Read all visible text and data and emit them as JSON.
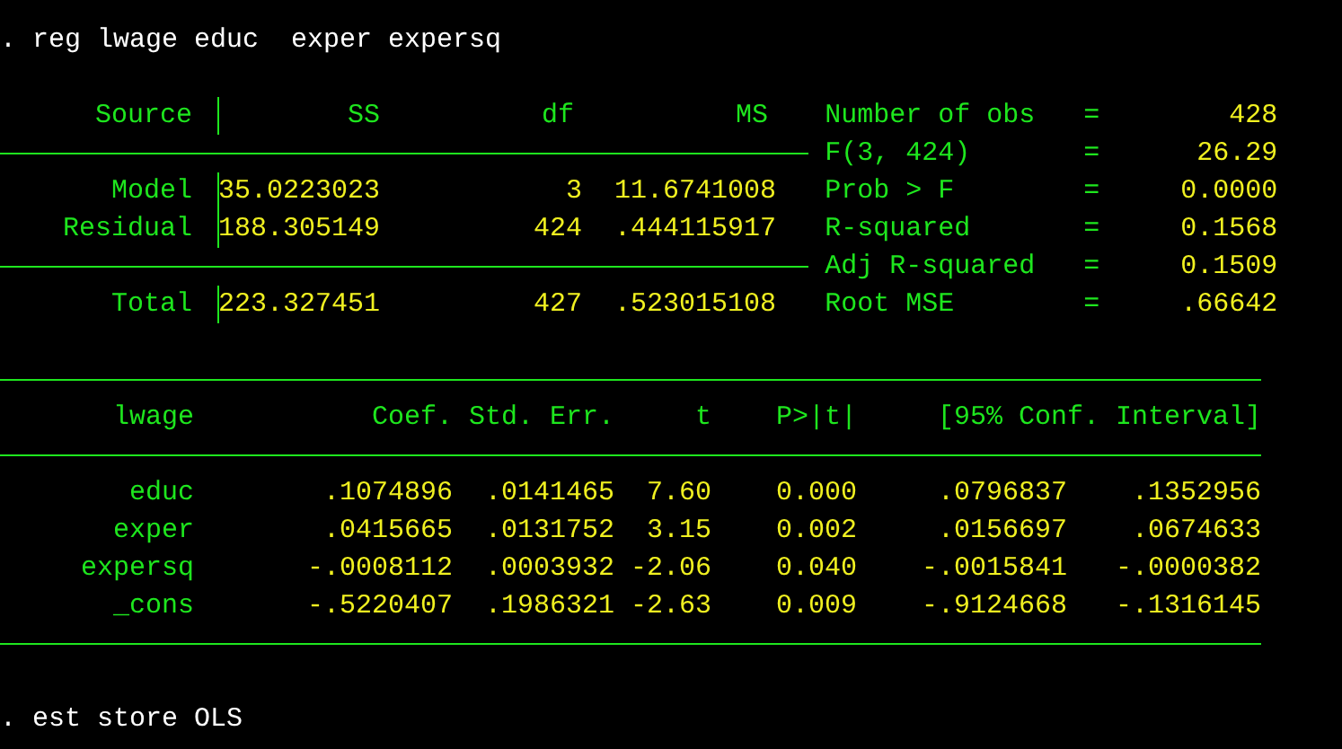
{
  "command": ". reg lwage educ  exper expersq",
  "anova": {
    "columns": [
      "Source",
      "SS",
      "df",
      "MS"
    ],
    "rows": [
      {
        "source": "Model",
        "ss": "35.0223023",
        "df": "3",
        "ms": "11.6741008"
      },
      {
        "source": "Residual",
        "ss": "188.305149",
        "df": "424",
        "ms": ".444115917"
      }
    ],
    "total": {
      "source": "Total",
      "ss": "223.327451",
      "df": "427",
      "ms": ".523015108"
    }
  },
  "stats": [
    {
      "label": "Number of obs",
      "relation": "=",
      "value": "428"
    },
    {
      "label": "F(3, 424)",
      "relation": "=",
      "value": "26.29"
    },
    {
      "label": "Prob > F",
      "relation": "=",
      "value": "0.0000"
    },
    {
      "label": "R-squared",
      "relation": "=",
      "value": "0.1568"
    },
    {
      "label": "Adj R-squared",
      "relation": "=",
      "value": "0.1509"
    },
    {
      "label": "Root MSE",
      "relation": "=",
      "value": ".66642"
    }
  ],
  "coef_table": {
    "columns": [
      "lwage",
      "Coef.",
      "Std. Err.",
      "t",
      "P>|t|",
      "[95% Conf. Interval]"
    ],
    "rows": [
      {
        "name": "educ",
        "values": [
          ".1074896",
          ".0141465",
          "7.60",
          "0.000",
          ".0796837",
          ".1352956"
        ]
      },
      {
        "name": "exper",
        "values": [
          ".0415665",
          ".0131752",
          "3.15",
          "0.002",
          ".0156697",
          ".0674633"
        ]
      },
      {
        "name": "expersq",
        "values": [
          "-.0008112",
          ".0003932",
          "-2.06",
          "0.040",
          "-.0015841",
          "-.0000382"
        ]
      },
      {
        "name": "_cons",
        "values": [
          "-.5220407",
          ".1986321",
          "-2.63",
          "0.009",
          "-.9124668",
          "-.1316145"
        ]
      }
    ]
  },
  "footer_command": ". est store OLS"
}
